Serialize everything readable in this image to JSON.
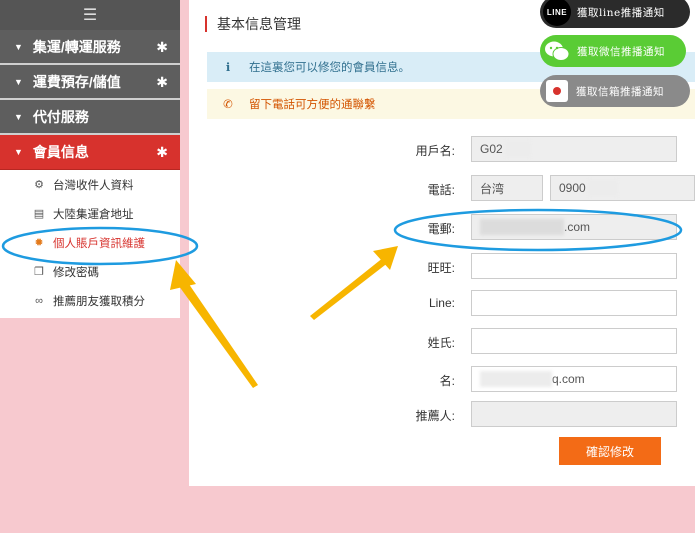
{
  "sidebar": {
    "toggle_icon": "menu-icon",
    "groups": [
      {
        "label": "集運/轉運服務"
      },
      {
        "label": "運費預存/儲值"
      },
      {
        "label": "代付服務"
      },
      {
        "label": "會員信息"
      }
    ],
    "items": [
      {
        "label": "台灣收件人資料",
        "icon": "users-icon"
      },
      {
        "label": "大陸集運倉地址",
        "icon": "document-icon"
      },
      {
        "label": "個人賬戶資訊維護",
        "icon": "gear-icon"
      },
      {
        "label": "修改密碼",
        "icon": "copy-icon"
      },
      {
        "label": "推薦朋友獲取積分",
        "icon": "link-icon"
      }
    ]
  },
  "main": {
    "title": "基本信息管理",
    "info_alert": "在這裏您可以修您的會員信息。",
    "warn_alert": "留下電話可方便的通聯繫",
    "fields": {
      "username_label": "用戶名:",
      "username_value": "G02",
      "phone_label": "電話:",
      "phone_country": "台湾",
      "phone_value": "0900",
      "email_label": "電郵:",
      "email_value": ".com",
      "wangwang_label": "旺旺:",
      "line_label": "Line:",
      "surname_label": "姓氏:",
      "name_label": "名:",
      "name_value": "q.com",
      "referrer_label": "推薦人:"
    },
    "submit_label": "確認修改"
  },
  "notify": {
    "line_label": "獲取line推播通知",
    "line_badge": "LINE",
    "wechat_label": "獲取微信推播通知",
    "mail_label": "獲取信箱推播通知"
  },
  "colors": {
    "accent_red": "#d7322d",
    "submit_orange": "#f36b16",
    "annotation_blue": "#1e9be0",
    "annotation_arrow": "#f7b500"
  }
}
